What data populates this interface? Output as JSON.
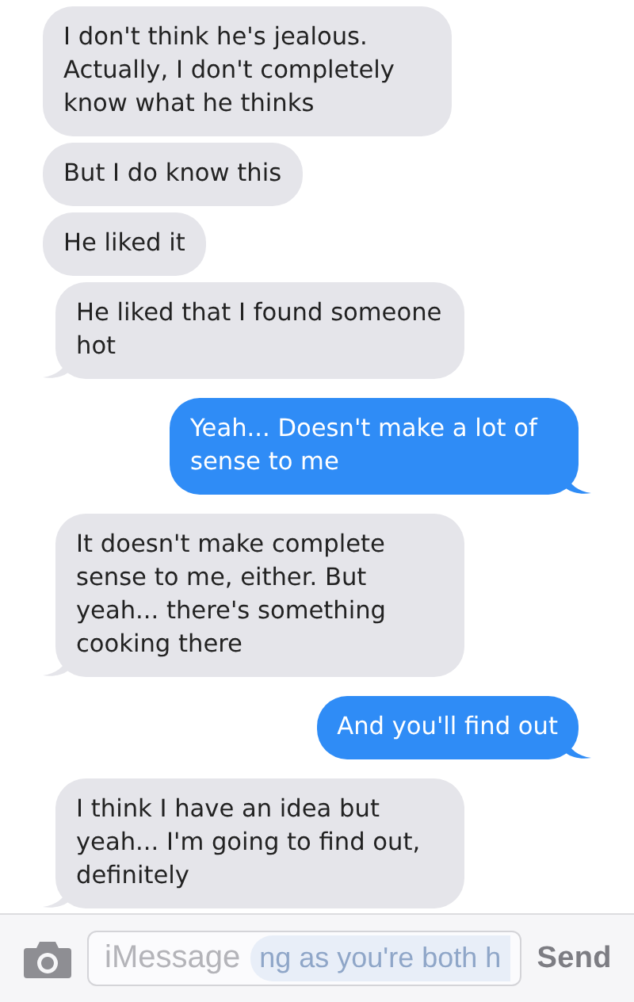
{
  "messages": [
    {
      "kind": "received",
      "text": "I don't think he's jealous. Actually, I don't completely know what he thinks",
      "tail": false
    },
    {
      "kind": "received",
      "text": "But I do know this",
      "tail": false
    },
    {
      "kind": "received",
      "text": "He liked it",
      "tail": false
    },
    {
      "kind": "received",
      "text": "He liked that I found someone hot",
      "tail": true
    },
    {
      "kind": "sent",
      "text": "Yeah... Doesn't make a lot of sense to me",
      "tail": true
    },
    {
      "kind": "received",
      "text": "It doesn't make complete sense to me, either. But yeah... there's something cooking there",
      "tail": true
    },
    {
      "kind": "sent",
      "text": "And you'll find out",
      "tail": true
    },
    {
      "kind": "received",
      "text": "I think I have an idea but yeah... I'm going to find out, definitely",
      "tail": true
    }
  ],
  "composer": {
    "placeholder": "iMessage",
    "ghost_text": "ng as you're both h",
    "send_label": "Send"
  }
}
